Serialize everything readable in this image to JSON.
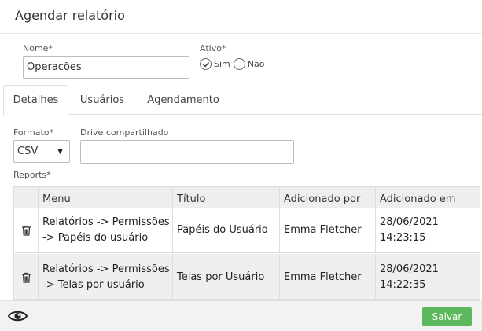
{
  "dialog": {
    "title": "Agendar relatório"
  },
  "form": {
    "name_label": "Nome*",
    "name_value": "Operacões",
    "active_label": "Ativo*",
    "active_yes": "Sim",
    "active_no": "Não",
    "active_selected": "Sim"
  },
  "tabs": [
    {
      "label": "Detalhes",
      "active": true
    },
    {
      "label": "Usuários",
      "active": false
    },
    {
      "label": "Agendamento",
      "active": false
    }
  ],
  "details": {
    "format_label": "Formato*",
    "format_value": "CSV",
    "drive_label": "Drive compartilhado",
    "drive_value": "",
    "reports_label": "Reports*"
  },
  "table": {
    "columns": [
      "Menu",
      "Título",
      "Adicionado por",
      "Adicionado em"
    ],
    "rows": [
      {
        "menu_line1": "Relatórios -> Permissões",
        "menu_line2": "-> Papéis do usuário",
        "title": "Papéis do Usuário",
        "added_by": "Emma Fletcher",
        "added_at": "28/06/2021 14:23:15"
      },
      {
        "menu_line1": "Relatórios -> Permissões",
        "menu_line2": "-> Telas por usuário",
        "title": "Telas por Usuário",
        "added_by": "Emma Fletcher",
        "added_at": "28/06/2021 14:22:35"
      }
    ]
  },
  "footer": {
    "save_label": "Salvar"
  },
  "colors": {
    "save_button": "#5cb85c",
    "check": "#333333"
  }
}
